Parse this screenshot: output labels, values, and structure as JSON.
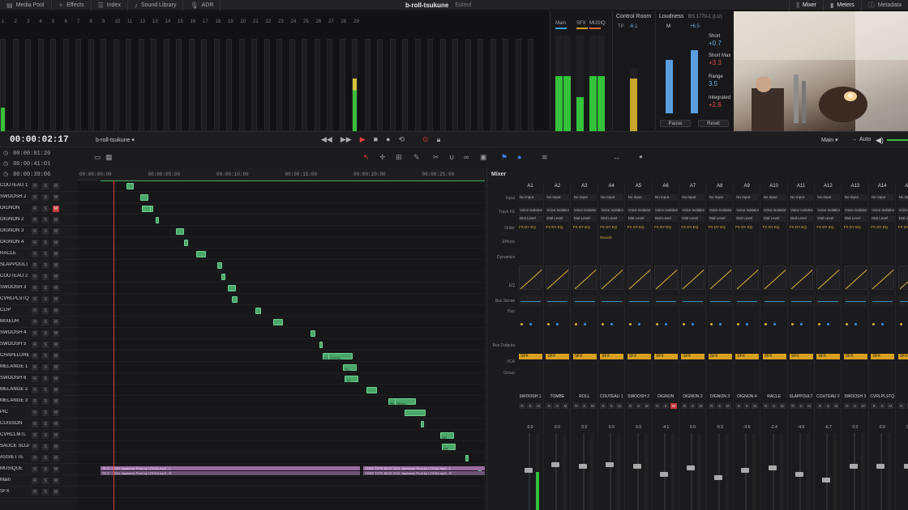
{
  "topbar": {
    "items": [
      {
        "icon": "media-pool-icon",
        "label": "Media Pool"
      },
      {
        "icon": "effects-icon",
        "label": "Effects"
      },
      {
        "icon": "index-icon",
        "label": "Index"
      },
      {
        "icon": "sound-library-icon",
        "label": "Sound Library"
      },
      {
        "icon": "adr-icon",
        "label": "ADR"
      }
    ],
    "project": "b-roll-tsukune",
    "status": "Edited",
    "right": [
      {
        "icon": "mixer-icon",
        "label": "Mixer"
      },
      {
        "icon": "meters-icon",
        "label": "Meters"
      },
      {
        "icon": "metadata-icon",
        "label": "Metadata"
      }
    ]
  },
  "track_meters": {
    "numbers": [
      "1",
      "2",
      "3",
      "4",
      "5",
      "6",
      "7",
      "8",
      "9",
      "10",
      "11",
      "12",
      "13",
      "14",
      "15",
      "16",
      "17",
      "18",
      "19",
      "20",
      "21",
      "22",
      "23",
      "24",
      "25",
      "26",
      "27",
      "28",
      "29"
    ],
    "levels": [
      0.3,
      0,
      0,
      0,
      0,
      0,
      0,
      0,
      0,
      0,
      0,
      0,
      0,
      0,
      0,
      0,
      0,
      0,
      0,
      0,
      0,
      0,
      0,
      0,
      0,
      0,
      0,
      0,
      0.6
    ]
  },
  "bus_meters": {
    "buses": [
      {
        "name": "Main",
        "color": "#3aa0d8",
        "levels": [
          0.6,
          0.6
        ]
      },
      {
        "name": "SFX",
        "color": "#d7a020",
        "levels": [
          0.4
        ]
      },
      {
        "name": "MUSIQ",
        "color": "#d86a3a",
        "levels": [
          0.6,
          0.6
        ]
      }
    ]
  },
  "control_room": {
    "title": "Control Room",
    "tp_label": "TP",
    "tp_value": "-6.1"
  },
  "loudness": {
    "title": "Loudness",
    "standard": "BS.1770-1 (LU)",
    "m_label": "M",
    "m_value": "+6.5",
    "short_label": "Short",
    "short_value": "+0.7",
    "short_max_label": "Short Max",
    "short_max_value": "+3.3",
    "range_label": "Range",
    "range_value": "3.5",
    "integrated_label": "Integrated",
    "integrated_value": "+2.6",
    "pause_label": "Pause",
    "reset_label": "Reset"
  },
  "timeline_header": {
    "timecode": "00:00:02:17",
    "name": "b-roll-tsukune",
    "bus_select": "Main",
    "auto_label": "Auto"
  },
  "timecodes": [
    "00:00:01:20",
    "00:00:41:01",
    "00:00:39:06"
  ],
  "ruler": [
    "00:00:00:00",
    "00:00:05:00",
    "00:00:10:00",
    "00:00:15:00",
    "00:00:20:00",
    "00:00:25:00"
  ],
  "tracks": [
    {
      "name": "COUTEAU 1"
    },
    {
      "name": "SWOOSH 2"
    },
    {
      "name": "OIGNON",
      "mute": true
    },
    {
      "name": "OIGNON 2"
    },
    {
      "name": "OIGNON 3"
    },
    {
      "name": "OIGNON 4"
    },
    {
      "name": "RACLE"
    },
    {
      "name": "SLAPPOULT"
    },
    {
      "name": "COUTEAU 2"
    },
    {
      "name": "SWOOSH 3"
    },
    {
      "name": "CVRLPLSTQ"
    },
    {
      "name": "CLIP"
    },
    {
      "name": "MIXEUR"
    },
    {
      "name": "SWOOSH 4"
    },
    {
      "name": "SWOOSH 5"
    },
    {
      "name": "CHAPELURE"
    },
    {
      "name": "MELANGE 1"
    },
    {
      "name": "SWOOSH 6"
    },
    {
      "name": "MELANGE 2"
    },
    {
      "name": "MELANGE 3"
    },
    {
      "name": "PIC"
    },
    {
      "name": "CUISSON"
    },
    {
      "name": "CVRCLMTL"
    },
    {
      "name": "SAUCE SOJA"
    },
    {
      "name": "ASSIETTE"
    },
    {
      "name": "MUSIQUE"
    },
    {
      "name": "Main"
    },
    {
      "name": "SFX"
    }
  ],
  "clips": [
    {
      "lane": 0,
      "t": 1.9,
      "d": 0.5
    },
    {
      "lane": 1,
      "t": 2.9,
      "d": 0.6
    },
    {
      "lane": 2,
      "t": 3.0,
      "d": 0.7
    },
    {
      "lane": 2,
      "t": 3.6,
      "d": 0.1
    },
    {
      "lane": 3,
      "t": 4.0,
      "d": 0.1
    },
    {
      "lane": 4,
      "t": 5.5,
      "d": 0.6
    },
    {
      "lane": 5,
      "t": 6.1,
      "d": 0.3
    },
    {
      "lane": 6,
      "t": 7.0,
      "d": 0.7
    },
    {
      "lane": 7,
      "t": 8.5,
      "d": 0.4
    },
    {
      "lane": 8,
      "t": 8.8,
      "d": 0.3
    },
    {
      "lane": 9,
      "t": 9.3,
      "d": 0.6
    },
    {
      "lane": 10,
      "t": 9.6,
      "d": 0.4
    },
    {
      "lane": 11,
      "t": 11.3,
      "d": 0.4
    },
    {
      "lane": 12,
      "t": 12.6,
      "d": 0.7
    },
    {
      "lane": 13,
      "t": 15.3,
      "d": 0.4
    },
    {
      "lane": 14,
      "t": 16.0,
      "d": 0.2
    },
    {
      "lane": 15,
      "t": 16.2,
      "d": 1.8,
      "label": "COC28..."
    },
    {
      "lane": 15,
      "t": 16.6,
      "d": 1.8,
      "label": "COC28..."
    },
    {
      "lane": 16,
      "t": 17.7,
      "d": 1.0,
      "label": "TO..."
    },
    {
      "lane": 17,
      "t": 17.8,
      "d": 1.0,
      "label": "TO..."
    },
    {
      "lane": 18,
      "t": 19.4,
      "d": 0.8
    },
    {
      "lane": 19,
      "t": 21.0,
      "d": 1.7,
      "label": "Mixeu..."
    },
    {
      "lane": 19,
      "t": 21.5,
      "d": 1.5,
      "label": "Mixeu..."
    },
    {
      "lane": 20,
      "t": 22.2,
      "d": 1.5
    },
    {
      "lane": 21,
      "t": 23.4,
      "d": 0.2
    },
    {
      "lane": 22,
      "t": 24.8,
      "d": 1.0,
      "label": "DR..."
    },
    {
      "lane": 23,
      "t": 24.9,
      "d": 1.0,
      "label": "DR..."
    },
    {
      "lane": 24,
      "t": 26.6,
      "d": 0.1
    },
    {
      "lane": 25,
      "t": 27.6,
      "d": 0.2
    }
  ],
  "music_clips": [
    {
      "t": 0,
      "d": 19.0,
      "label": "TE 0´ · 2021 Japanese Prod.by LOGA4.mp3 - L"
    },
    {
      "t": 0,
      "d": 19.0,
      "label": "TE 0´ · 2021 Japanese Prod.by LOGA4.mp3 - R"
    },
    {
      "t": 19.2,
      "d": 9.0,
      "label": "FREE TYPE BEAT 2021 Japanese Prod.by LOGA4.mp3 - L"
    },
    {
      "t": 19.2,
      "d": 9.0,
      "label": "FREE TYPE BEAT 2021 Japanese Prod.by LOGA4.mp3 - R"
    }
  ],
  "mixer": {
    "title": "Mixer",
    "row_labels": [
      "Input",
      "Track FX",
      "Order",
      "Effects",
      "Dynamics",
      "EQ",
      "Bus Sends",
      "Pan",
      "Bus Outputs",
      "VCA",
      "Group"
    ],
    "input_value": "No Input",
    "trackfx": [
      "Voice Isolation",
      "Dial Level"
    ],
    "order_value": "FX DY EQ",
    "reverb_label": "Reverb",
    "bus_output": "SFX",
    "channels": [
      {
        "id": "A1",
        "name": "SWOOSH 1",
        "gain": "0.0",
        "level": 0.5,
        "knob": 0.45
      },
      {
        "id": "A2",
        "name": "TOMBE",
        "gain": "0.0",
        "level": 0,
        "knob": 0.38
      },
      {
        "id": "A3",
        "name": "ROLL",
        "gain": "0.0",
        "level": 0,
        "knob": 0.4
      },
      {
        "id": "A4",
        "name": "COUTEAU 1",
        "gain": "0.0",
        "level": 0,
        "knob": 0.38,
        "reverb": true
      },
      {
        "id": "A5",
        "name": "SWOOSH 2",
        "gain": "0.0",
        "level": 0,
        "knob": 0.4
      },
      {
        "id": "A6",
        "name": "OIGNON",
        "gain": "-4.1",
        "level": 0,
        "knob": 0.5,
        "mute": true
      },
      {
        "id": "A7",
        "name": "OIGNON 2",
        "gain": "0.0",
        "level": 0,
        "knob": 0.42
      },
      {
        "id": "A8",
        "name": "OIGNON 3",
        "gain": "-5.5",
        "level": 0,
        "knob": 0.55
      },
      {
        "id": "A9",
        "name": "OIGNON 4",
        "gain": "-3.5",
        "level": 0,
        "knob": 0.45
      },
      {
        "id": "A10",
        "name": "RACLE",
        "gain": "-2.4",
        "level": 0,
        "knob": 0.42
      },
      {
        "id": "A11",
        "name": "SLAPPOULT",
        "gain": "-4.0",
        "level": 0,
        "knob": 0.5
      },
      {
        "id": "A12",
        "name": "COUTEAU 2",
        "gain": "-6.7",
        "level": 0,
        "knob": 0.58
      },
      {
        "id": "A13",
        "name": "SWOOSH 3",
        "gain": "0.0",
        "level": 0,
        "knob": 0.4
      },
      {
        "id": "A14",
        "name": "CVRLPLSTQ",
        "gain": "0.0",
        "level": 0,
        "knob": 0.4
      },
      {
        "id": "A15",
        "name": "C",
        "gain": "0.0",
        "level": 0,
        "knob": 0.4
      }
    ]
  }
}
